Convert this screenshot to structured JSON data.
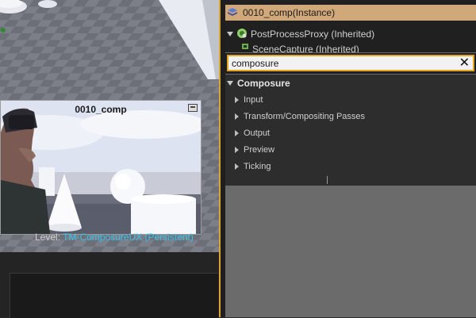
{
  "viewport": {
    "preview_title": "0010_comp",
    "level_prefix": "Level:",
    "level_name": "TM-ComposureUX (Persistent)"
  },
  "outliner": {
    "selected_item": "0010_comp(Instance)",
    "post_process_item": "PostProcessProxy (Inherited)",
    "scene_capture_item": "SceneCapture (Inherited)"
  },
  "search": {
    "value": "composure"
  },
  "details": {
    "category": "Composure",
    "sections": [
      "Input",
      "Transform/Compositing Passes",
      "Output",
      "Preview",
      "Ticking"
    ]
  },
  "colors": {
    "accent": "#e5a623",
    "selected_row": "#d1a879",
    "level_name": "#35c4f0"
  }
}
